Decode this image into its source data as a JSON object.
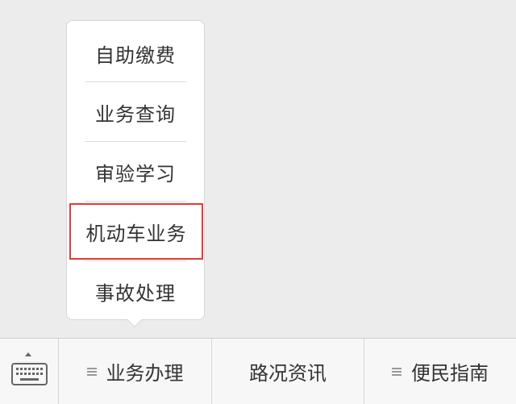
{
  "popup_menu": {
    "items": [
      {
        "label": "自助缴费"
      },
      {
        "label": "业务查询"
      },
      {
        "label": "审验学习"
      },
      {
        "label": "机动车业务"
      },
      {
        "label": "事故处理"
      }
    ],
    "highlight_color": "#e53935"
  },
  "bottom_bar": {
    "keyboard_icon": "keyboard-icon",
    "tabs": [
      {
        "label": "业务办理",
        "has_menu_icon": true
      },
      {
        "label": "路况资讯",
        "has_menu_icon": false
      },
      {
        "label": "便民指南",
        "has_menu_icon": true
      }
    ]
  }
}
